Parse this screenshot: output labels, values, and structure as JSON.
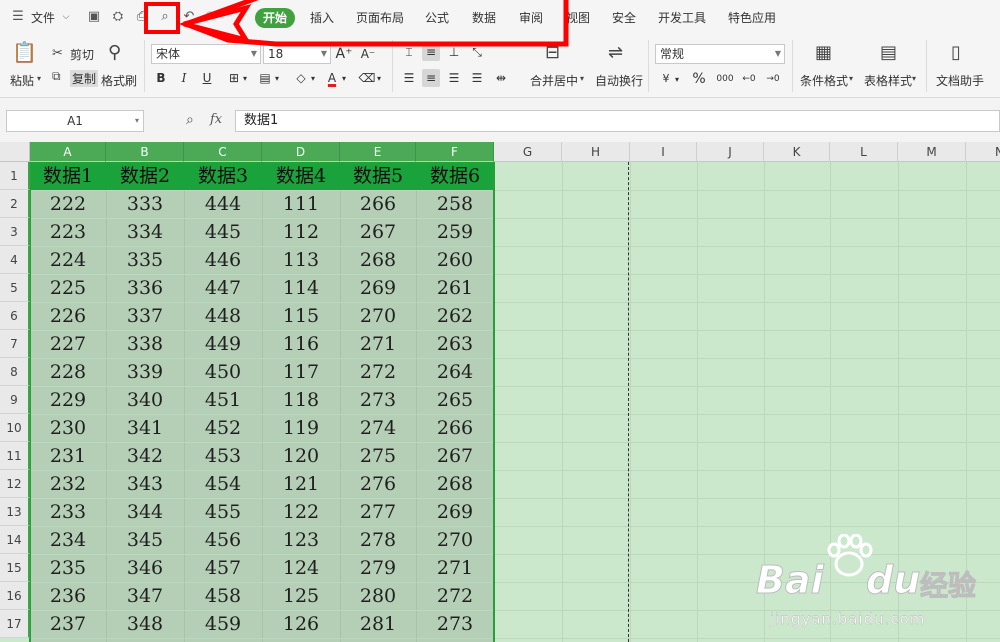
{
  "menu": {
    "app_menu_label": "文件",
    "tabs": [
      {
        "label": "开始",
        "active": true
      },
      {
        "label": "插入"
      },
      {
        "label": "页面布局"
      },
      {
        "label": "公式"
      },
      {
        "label": "数据"
      },
      {
        "label": "审阅"
      },
      {
        "label": "视图"
      },
      {
        "label": "安全"
      },
      {
        "label": "开发工具"
      },
      {
        "label": "特色应用"
      }
    ]
  },
  "ribbon": {
    "paste": "粘贴",
    "cut": "剪切",
    "copy": "复制",
    "format_painter": "格式刷",
    "font_name": "宋体",
    "font_size": "18",
    "bold": "B",
    "italic": "I",
    "underline": "U",
    "merge_center": "合并居中",
    "wrap_text": "自动换行",
    "number_format": "常规",
    "percent": "%",
    "thousands": "000",
    "conditional_format": "条件格式",
    "table_style": "表格样式",
    "doc_assistant": "文档助手"
  },
  "formula_bar": {
    "name_box": "A1",
    "fx": "fx",
    "content": "数据1"
  },
  "sheet": {
    "columns": [
      "A",
      "B",
      "C",
      "D",
      "E",
      "F",
      "G",
      "H",
      "I",
      "J",
      "K",
      "L",
      "M",
      "N"
    ],
    "row_numbers": [
      "1",
      "2",
      "3",
      "4",
      "5",
      "6",
      "7",
      "8",
      "9",
      "10",
      "11",
      "12",
      "13",
      "14",
      "15",
      "16",
      "17"
    ],
    "header_row": [
      "数据1",
      "数据2",
      "数据3",
      "数据4",
      "数据5",
      "数据6"
    ],
    "rows": [
      [
        "222",
        "333",
        "444",
        "111",
        "266",
        "258"
      ],
      [
        "223",
        "334",
        "445",
        "112",
        "267",
        "259"
      ],
      [
        "224",
        "335",
        "446",
        "113",
        "268",
        "260"
      ],
      [
        "225",
        "336",
        "447",
        "114",
        "269",
        "261"
      ],
      [
        "226",
        "337",
        "448",
        "115",
        "270",
        "262"
      ],
      [
        "227",
        "338",
        "449",
        "116",
        "271",
        "263"
      ],
      [
        "228",
        "339",
        "450",
        "117",
        "272",
        "264"
      ],
      [
        "229",
        "340",
        "451",
        "118",
        "273",
        "265"
      ],
      [
        "230",
        "341",
        "452",
        "119",
        "274",
        "266"
      ],
      [
        "231",
        "342",
        "453",
        "120",
        "275",
        "267"
      ],
      [
        "232",
        "343",
        "454",
        "121",
        "276",
        "268"
      ],
      [
        "233",
        "344",
        "455",
        "122",
        "277",
        "269"
      ],
      [
        "234",
        "345",
        "456",
        "123",
        "278",
        "270"
      ],
      [
        "235",
        "346",
        "457",
        "124",
        "279",
        "271"
      ],
      [
        "236",
        "347",
        "458",
        "125",
        "280",
        "272"
      ],
      [
        "237",
        "348",
        "459",
        "126",
        "281",
        "273"
      ]
    ]
  },
  "watermark": {
    "brand": "Bai",
    "brand2": "du",
    "cn": "经验",
    "url": "jingyan.baidu.com"
  },
  "colors": {
    "accent": "#3fa23f",
    "annotation": "#ff0000",
    "sheet_bg": "#cbe8cd",
    "header_fill": "#1aa23b"
  }
}
